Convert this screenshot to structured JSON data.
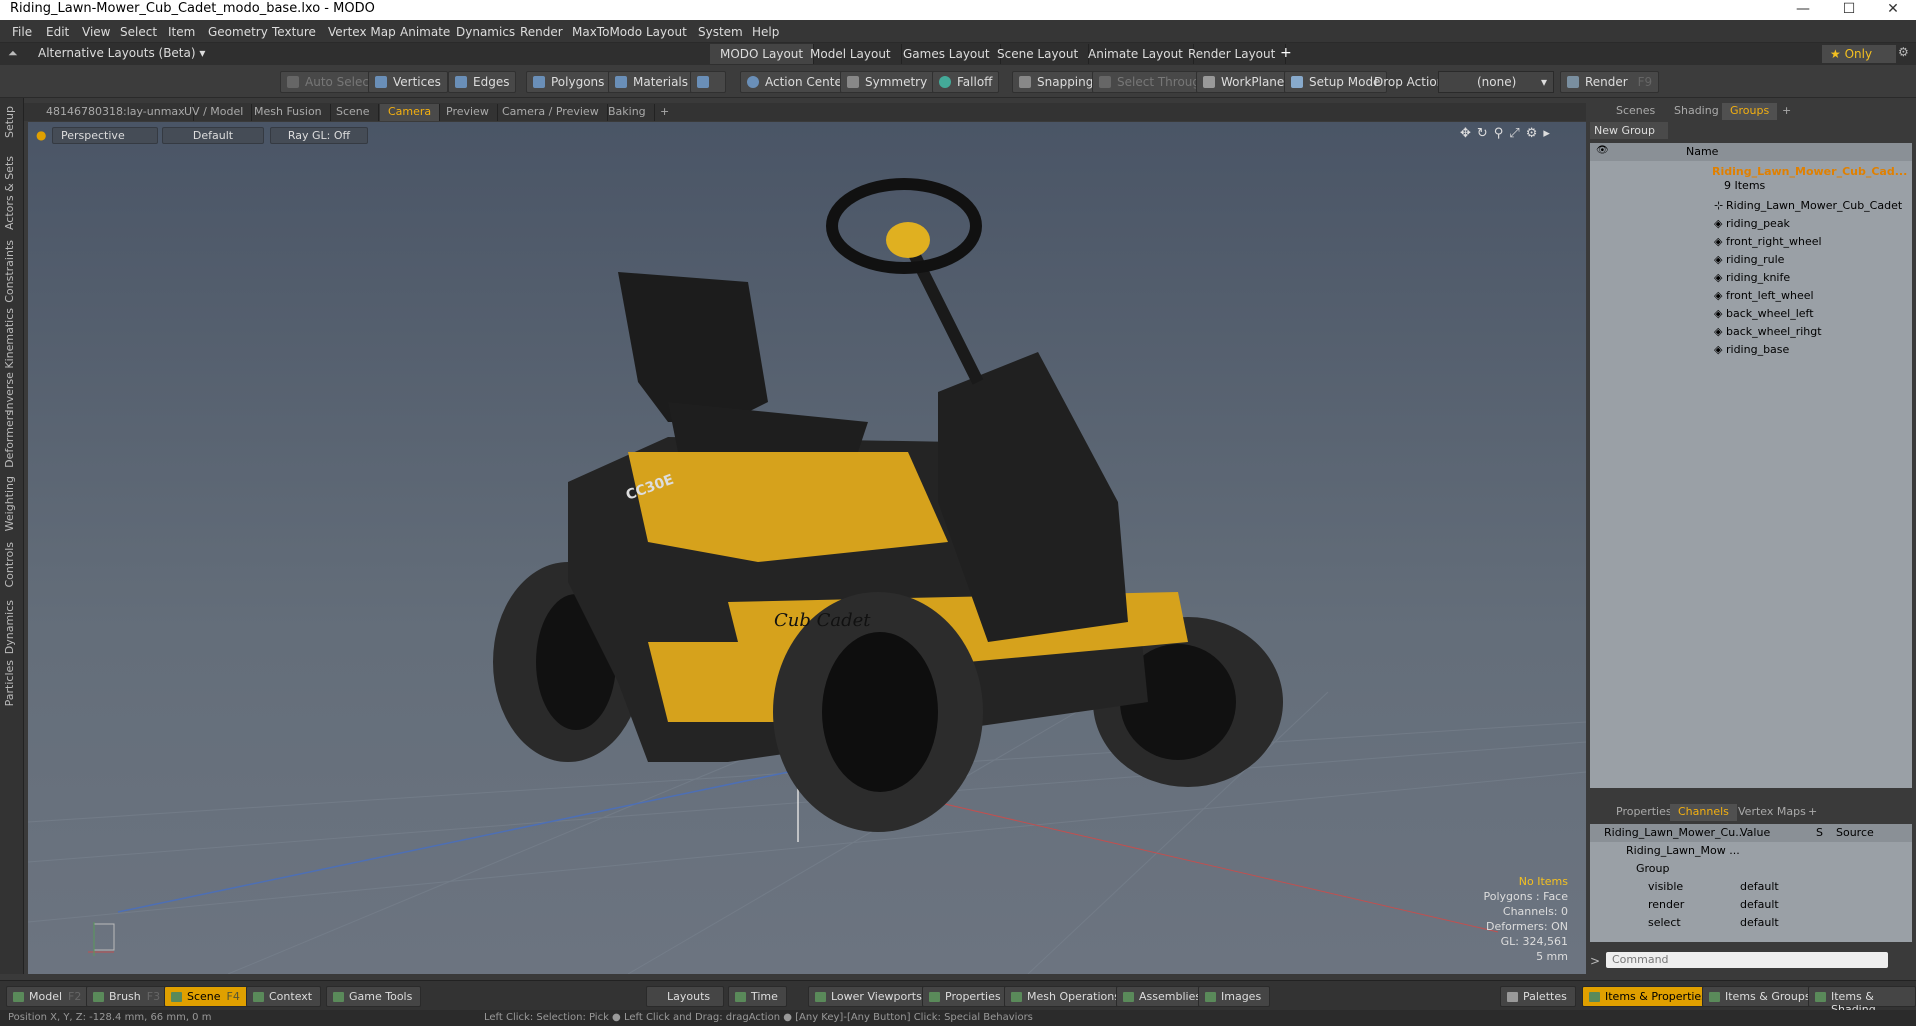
{
  "window": {
    "title": "Riding_Lawn-Mower_Cub_Cadet_modo_base.lxo - MODO",
    "min": "—",
    "max": "☐",
    "close": "✕"
  },
  "menu": [
    "File",
    "Edit",
    "View",
    "Select",
    "Item",
    "Geometry",
    "Texture",
    "Vertex Map",
    "Animate",
    "Dynamics",
    "Render",
    "MaxToModo",
    "Layout",
    "System",
    "Help"
  ],
  "layouts": {
    "alt": "Alternative Layouts (Beta) ▾",
    "tabs": [
      "MODO Layout",
      "Model Layout",
      "Games Layout",
      "Scene Layout",
      "Animate Layout",
      "Render Layout"
    ],
    "plus": "+",
    "only": "★  Only"
  },
  "toolbar": {
    "auto_select": "Auto Select",
    "vertices": "Vertices",
    "edges": "Edges",
    "polygons": "Polygons",
    "materials": "Materials",
    "action_center": "Action Center",
    "symmetry": "Symmetry",
    "falloff": "Falloff",
    "snapping": "Snapping",
    "select_through": "Select Through",
    "workplane": "WorkPlane",
    "setup_mode": "Setup Mode",
    "drop_action": "Drop Action",
    "none": "(none)",
    "render": "Render",
    "render_key": "F9"
  },
  "left_tabs": [
    "Setup",
    "Actors & Sets",
    "Constraints",
    "Inverse Kinematics",
    "Deformers",
    "Weighting",
    "Controls",
    "Dynamics",
    "Particles"
  ],
  "viewport_tabs": [
    "48146780318:lay-unmax",
    "UV / Model",
    "Mesh Fusion",
    "Scene",
    "Camera",
    "Preview",
    "Camera / Preview",
    "Baking",
    "+"
  ],
  "viewport": {
    "perspective": "Perspective",
    "default": "Default",
    "raygl": "Ray GL: Off",
    "info": [
      "No Items",
      "Polygons : Face",
      "Channels: 0",
      "Deformers: ON",
      "GL: 324,561",
      "5 mm"
    ],
    "brand": "Cub Cadet",
    "model": "CC30E"
  },
  "right_tabs": [
    "Scenes",
    "Shading",
    "Groups",
    "+"
  ],
  "groups": {
    "new_group": "New Group",
    "name_col": "Name",
    "root": "Riding_Lawn_Mower_Cub_Cad...",
    "count": "9 Items",
    "items": [
      "Riding_Lawn_Mower_Cub_Cadet",
      "riding_peak",
      "front_right_wheel",
      "riding_rule",
      "riding_knife",
      "front_left_wheel",
      "back_wheel_left",
      "back_wheel_rihgt",
      "riding_base"
    ]
  },
  "props_tabs": [
    "Properties",
    "Channels",
    "Vertex Maps",
    "+"
  ],
  "channels": {
    "head": [
      "Riding_Lawn_Mower_Cu...",
      "Value",
      "S",
      "Source"
    ],
    "item": "Riding_Lawn_Mow ...",
    "group": "Group",
    "rows": [
      {
        "name": "visible",
        "value": "default"
      },
      {
        "name": "render",
        "value": "default"
      },
      {
        "name": "select",
        "value": "default"
      }
    ]
  },
  "command": "Command",
  "bottom": {
    "model": "Model",
    "model_key": "F2",
    "brush": "Brush",
    "brush_key": "F3",
    "scene": "Scene",
    "scene_key": "F4",
    "context": "Context",
    "game_tools": "Game Tools",
    "layouts": "Layouts",
    "time": "Time",
    "lower_viewports": "Lower Viewports",
    "properties": "Properties",
    "mesh_operations": "Mesh Operations",
    "assemblies": "Assemblies",
    "images": "Images",
    "palettes": "Palettes",
    "items_properties": "Items & Properties",
    "items_groups": "Items & Groups",
    "items_shading": "Items & Shading"
  },
  "status": {
    "position": "Position X, Y, Z:  -128.4 mm, 66 mm, 0 m",
    "hint": "Left Click: Selection: Pick ● Left Click and Drag: dragAction ● [Any Key]-[Any Button] Click: Special Behaviors"
  }
}
